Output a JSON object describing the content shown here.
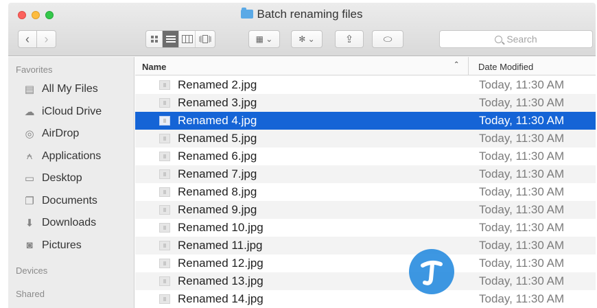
{
  "window": {
    "title": "Batch renaming files"
  },
  "toolbar": {
    "back_glyph": "‹",
    "forward_glyph": "›",
    "views": [
      "icon-view-icon",
      "list-view-icon",
      "column-view-icon",
      "cover-flow-icon"
    ],
    "arrange_glyph": "▦ ⌄",
    "action_glyph": "✻ ⌄",
    "share_glyph": "⇪",
    "tag_glyph": "⬭"
  },
  "search": {
    "placeholder": "Search"
  },
  "sidebar": {
    "favorites_heading": "Favorites",
    "items": [
      {
        "label": "All My Files",
        "icon": "all-files-icon",
        "glyph": "▤"
      },
      {
        "label": "iCloud Drive",
        "icon": "cloud-icon",
        "glyph": "☁"
      },
      {
        "label": "AirDrop",
        "icon": "airdrop-icon",
        "glyph": "◎"
      },
      {
        "label": "Applications",
        "icon": "applications-icon",
        "glyph": "⍲"
      },
      {
        "label": "Desktop",
        "icon": "desktop-icon",
        "glyph": "▭"
      },
      {
        "label": "Documents",
        "icon": "documents-icon",
        "glyph": "❐"
      },
      {
        "label": "Downloads",
        "icon": "downloads-icon",
        "glyph": "⬇"
      },
      {
        "label": "Pictures",
        "icon": "pictures-icon",
        "glyph": "◙"
      }
    ],
    "devices_heading": "Devices",
    "shared_heading": "Shared"
  },
  "list": {
    "name_header": "Name",
    "date_header": "Date Modified",
    "sort_glyph": "⌃",
    "files": [
      {
        "name": "Renamed 2.jpg",
        "date": "Today, 11:30 AM"
      },
      {
        "name": "Renamed 3.jpg",
        "date": "Today, 11:30 AM"
      },
      {
        "name": "Renamed 4.jpg",
        "date": "Today, 11:30 AM",
        "selected": true
      },
      {
        "name": "Renamed 5.jpg",
        "date": "Today, 11:30 AM"
      },
      {
        "name": "Renamed 6.jpg",
        "date": "Today, 11:30 AM"
      },
      {
        "name": "Renamed 7.jpg",
        "date": "Today, 11:30 AM"
      },
      {
        "name": "Renamed 8.jpg",
        "date": "Today, 11:30 AM"
      },
      {
        "name": "Renamed 9.jpg",
        "date": "Today, 11:30 AM"
      },
      {
        "name": "Renamed 10.jpg",
        "date": "Today, 11:30 AM"
      },
      {
        "name": "Renamed 11.jpg",
        "date": "Today, 11:30 AM"
      },
      {
        "name": "Renamed 12.jpg",
        "date": "Today, 11:30 AM"
      },
      {
        "name": "Renamed 13.jpg",
        "date": "Today, 11:30 AM"
      },
      {
        "name": "Renamed 14.jpg",
        "date": "Today, 11:30 AM"
      }
    ]
  },
  "colors": {
    "selection": "#1564d6",
    "close": "#fc615d",
    "minimize": "#fdbc40",
    "maximize": "#34c84a",
    "watermark": "#2d8fe0"
  }
}
